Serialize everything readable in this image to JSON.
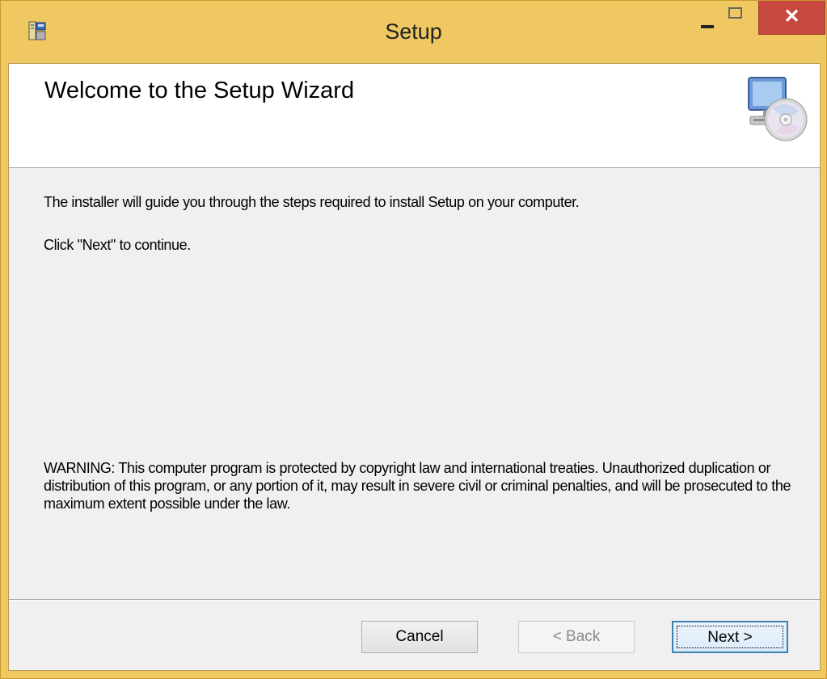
{
  "window": {
    "title": "Setup",
    "close_glyph": "✕"
  },
  "banner": {
    "title": "Welcome to the Setup Wizard",
    "icon": "computer-cd-icon"
  },
  "body": {
    "intro": "The installer will guide you through the steps required to install Setup on your computer.",
    "instruction": "Click \"Next\" to continue.",
    "warning": "WARNING: This computer program is protected by copyright law and international treaties. Unauthorized duplication or distribution of this program, or any portion of it, may result in severe civil or criminal penalties, and will be prosecuted to the maximum extent possible under the law."
  },
  "buttons": {
    "cancel": "Cancel",
    "back": "< Back",
    "next": "Next >"
  },
  "colors": {
    "title_bar": "#f0c862",
    "close_button": "#c7483f",
    "client_background": "#f0f0f0",
    "banner_background": "#ffffff"
  }
}
